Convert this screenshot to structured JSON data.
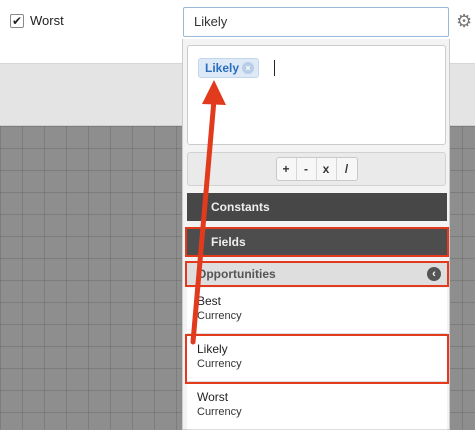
{
  "worst_checkbox": {
    "label": "Worst",
    "checked": true
  },
  "formula_input": {
    "value": "Likely"
  },
  "editor": {
    "token_label": "Likely"
  },
  "operators": [
    "+",
    "-",
    "x",
    "/"
  ],
  "sections": {
    "constants": "Constants",
    "fields": "Fields",
    "opportunities": "Opportunities"
  },
  "fields": [
    {
      "name": "Best",
      "type": "Currency"
    },
    {
      "name": "Likely",
      "type": "Currency"
    },
    {
      "name": "Worst",
      "type": "Currency"
    }
  ],
  "colors": {
    "annotation": "#e23a1d",
    "token_bg": "#dde9f7",
    "token_text": "#2b6dbf",
    "section_dark": "#474747"
  },
  "icons": {
    "gear": "gear-icon",
    "token_remove": "remove-token-icon",
    "collapse": "collapse-icon",
    "checkbox": "checkbox-icon"
  }
}
